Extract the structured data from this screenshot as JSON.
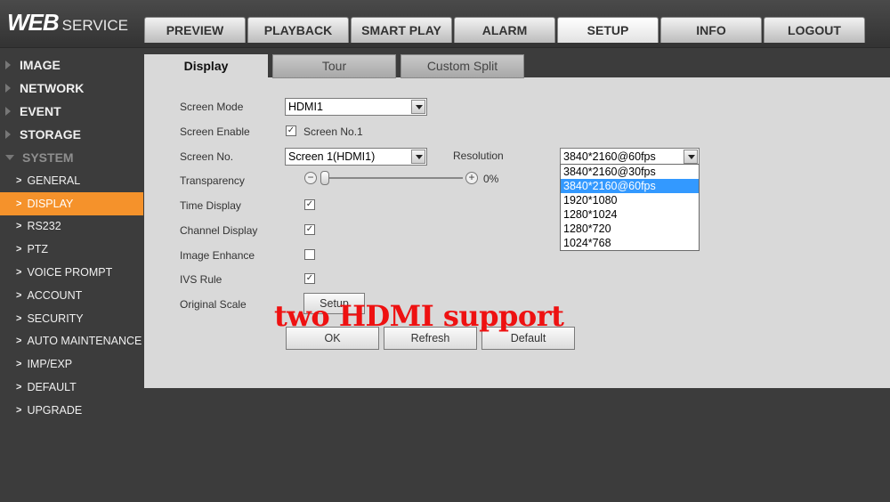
{
  "header": {
    "logo_main": "WEB",
    "logo_sub": "SERVICE",
    "nav": [
      "PREVIEW",
      "PLAYBACK",
      "SMART PLAY",
      "ALARM",
      "SETUP",
      "INFO",
      "LOGOUT"
    ],
    "active_nav": "SETUP"
  },
  "sidebar": {
    "sections": [
      "IMAGE",
      "NETWORK",
      "EVENT",
      "STORAGE",
      "SYSTEM"
    ],
    "system_items": [
      "GENERAL",
      "DISPLAY",
      "RS232",
      "PTZ",
      "VOICE PROMPT",
      "ACCOUNT",
      "SECURITY",
      "AUTO MAINTENANCE",
      "IMP/EXP",
      "DEFAULT",
      "UPGRADE"
    ],
    "active_item": "DISPLAY"
  },
  "tabs": [
    "Display",
    "Tour",
    "Custom Split"
  ],
  "form": {
    "screen_mode_label": "Screen Mode",
    "screen_mode_value": "HDMI1",
    "screen_enable_label": "Screen Enable",
    "screen_enable_value": "Screen No.1",
    "screen_no_label": "Screen No.",
    "screen_no_value": "Screen 1(HDMI1)",
    "resolution_label": "Resolution",
    "resolution_value": "3840*2160@60fps",
    "transparency_label": "Transparency",
    "transparency_value": "0%",
    "time_display_label": "Time Display",
    "channel_display_label": "Channel Display",
    "image_enhance_label": "Image Enhance",
    "ivs_rule_label": "IVS Rule",
    "original_scale_label": "Original Scale",
    "setup_button": "Setup",
    "checks": {
      "screen_enable": true,
      "time_display": true,
      "channel_display": true,
      "image_enhance": false,
      "ivs_rule": true
    },
    "check_mark": "✓"
  },
  "resolution_options": [
    "3840*2160@30fps",
    "3840*2160@60fps",
    "1920*1080",
    "1280*1024",
    "1280*720",
    "1024*768"
  ],
  "resolution_selected_index": 1,
  "buttons": {
    "ok": "OK",
    "refresh": "Refresh",
    "default": "Default"
  },
  "overlay_text": "two HDMI support",
  "colors": {
    "accent": "#f5922b",
    "highlight": "#3399ff",
    "overlay": "#ee1111"
  }
}
